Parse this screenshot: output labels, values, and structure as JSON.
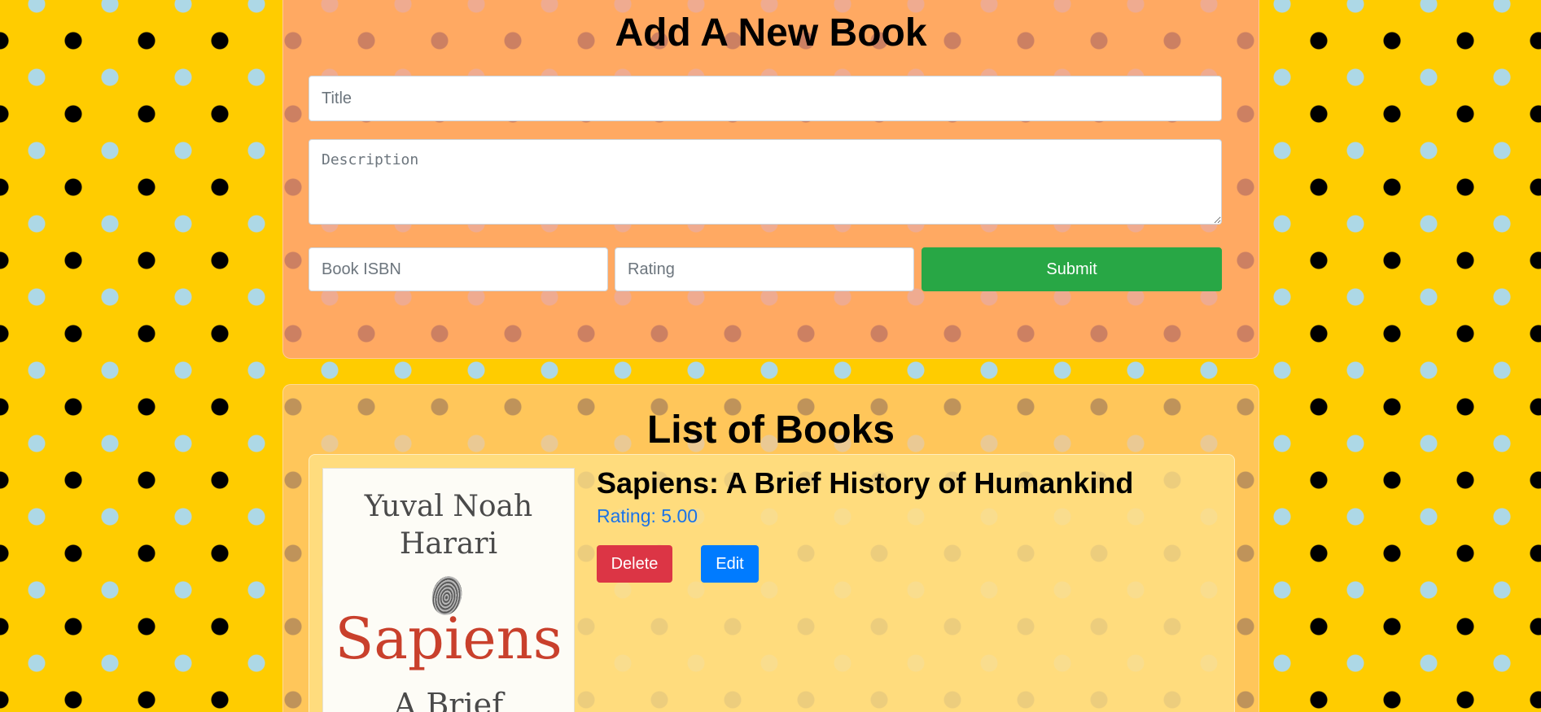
{
  "form": {
    "heading": "Add A New Book",
    "title_placeholder": "Title",
    "description_placeholder": "Description",
    "isbn_placeholder": "Book ISBN",
    "rating_placeholder": "Rating",
    "submit_label": "Submit"
  },
  "list": {
    "heading": "List of Books",
    "books": [
      {
        "title": "Sapiens: A Brief History of Humankind",
        "rating_text": "Rating: 5.00",
        "cover": {
          "author": "Yuval Noah Harari",
          "title": "Sapiens",
          "subtitle": "A Brief"
        },
        "delete_label": "Delete",
        "edit_label": "Edit"
      }
    ]
  },
  "colors": {
    "background": "#ffcc00",
    "submit": "#28a745",
    "delete": "#dc3545",
    "edit": "#007bff",
    "rating": "#1a73e8"
  }
}
